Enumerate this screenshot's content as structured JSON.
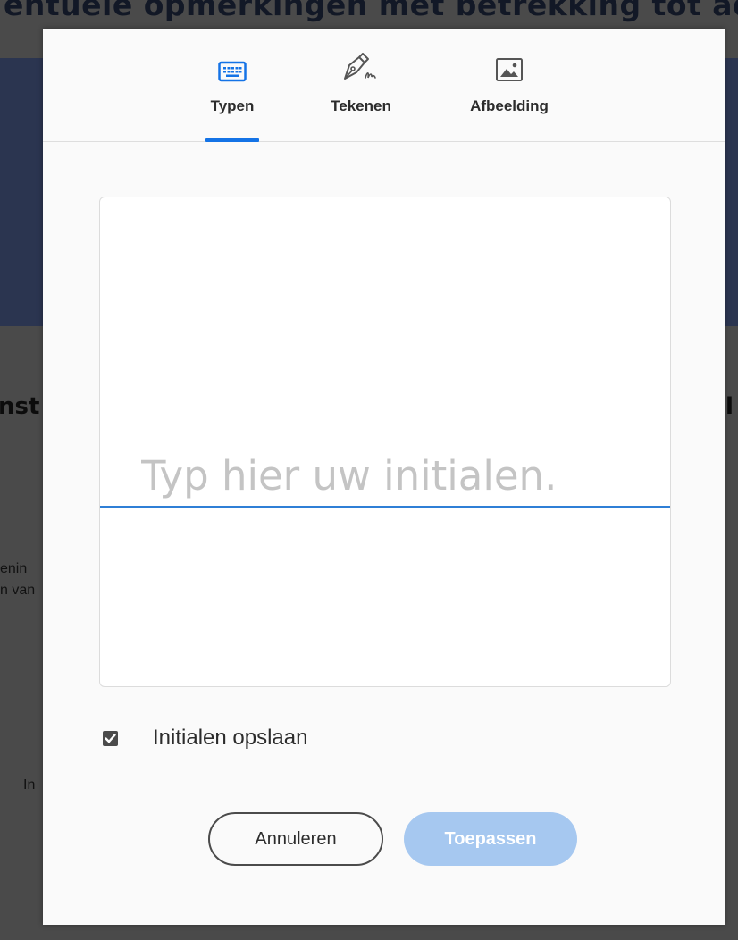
{
  "background": {
    "heading": "entuele opmerkingen met betrekking tot adv",
    "subheading_left": "nst",
    "subheading_right": "l",
    "text_1": "enin",
    "text_2": "n van",
    "text_3": "In"
  },
  "tabs": [
    {
      "label": "Typen",
      "icon": "keyboard-icon",
      "active": true
    },
    {
      "label": "Tekenen",
      "icon": "pen-sign-icon",
      "active": false
    },
    {
      "label": "Afbeelding",
      "icon": "image-icon",
      "active": false
    }
  ],
  "signature": {
    "placeholder": "Typ hier uw initialen.",
    "value": ""
  },
  "save_option": {
    "label": "Initialen opslaan",
    "checked": true
  },
  "buttons": {
    "cancel": "Annuleren",
    "apply": "Toepassen"
  },
  "colors": {
    "accent": "#1473e6",
    "apply_disabled": "#a6c8f0",
    "input_underline": "#2f7fd6"
  }
}
